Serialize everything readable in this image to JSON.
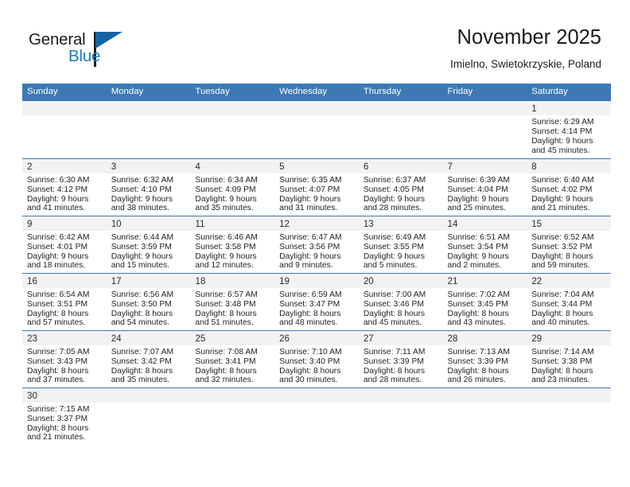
{
  "brand": {
    "name_top": "General",
    "name_bottom": "Blue",
    "accent_color": "#1a7cc4",
    "flag_color": "#1464a5"
  },
  "header": {
    "month_title": "November 2025",
    "location": "Imielno, Swietokrzyskie, Poland"
  },
  "calendar": {
    "header_color": "#3c79b4",
    "daynum_band_color": "#f2f2f2",
    "weekday_headers": [
      "Sunday",
      "Monday",
      "Tuesday",
      "Wednesday",
      "Thursday",
      "Friday",
      "Saturday"
    ],
    "weeks": [
      [
        {
          "blank": true
        },
        {
          "blank": true
        },
        {
          "blank": true
        },
        {
          "blank": true
        },
        {
          "blank": true
        },
        {
          "blank": true
        },
        {
          "day": "1",
          "sunrise": "Sunrise: 6:29 AM",
          "sunset": "Sunset: 4:14 PM",
          "daylight_1": "Daylight: 9 hours",
          "daylight_2": "and 45 minutes."
        }
      ],
      [
        {
          "day": "2",
          "sunrise": "Sunrise: 6:30 AM",
          "sunset": "Sunset: 4:12 PM",
          "daylight_1": "Daylight: 9 hours",
          "daylight_2": "and 41 minutes."
        },
        {
          "day": "3",
          "sunrise": "Sunrise: 6:32 AM",
          "sunset": "Sunset: 4:10 PM",
          "daylight_1": "Daylight: 9 hours",
          "daylight_2": "and 38 minutes."
        },
        {
          "day": "4",
          "sunrise": "Sunrise: 6:34 AM",
          "sunset": "Sunset: 4:09 PM",
          "daylight_1": "Daylight: 9 hours",
          "daylight_2": "and 35 minutes."
        },
        {
          "day": "5",
          "sunrise": "Sunrise: 6:35 AM",
          "sunset": "Sunset: 4:07 PM",
          "daylight_1": "Daylight: 9 hours",
          "daylight_2": "and 31 minutes."
        },
        {
          "day": "6",
          "sunrise": "Sunrise: 6:37 AM",
          "sunset": "Sunset: 4:05 PM",
          "daylight_1": "Daylight: 9 hours",
          "daylight_2": "and 28 minutes."
        },
        {
          "day": "7",
          "sunrise": "Sunrise: 6:39 AM",
          "sunset": "Sunset: 4:04 PM",
          "daylight_1": "Daylight: 9 hours",
          "daylight_2": "and 25 minutes."
        },
        {
          "day": "8",
          "sunrise": "Sunrise: 6:40 AM",
          "sunset": "Sunset: 4:02 PM",
          "daylight_1": "Daylight: 9 hours",
          "daylight_2": "and 21 minutes."
        }
      ],
      [
        {
          "day": "9",
          "sunrise": "Sunrise: 6:42 AM",
          "sunset": "Sunset: 4:01 PM",
          "daylight_1": "Daylight: 9 hours",
          "daylight_2": "and 18 minutes."
        },
        {
          "day": "10",
          "sunrise": "Sunrise: 6:44 AM",
          "sunset": "Sunset: 3:59 PM",
          "daylight_1": "Daylight: 9 hours",
          "daylight_2": "and 15 minutes."
        },
        {
          "day": "11",
          "sunrise": "Sunrise: 6:46 AM",
          "sunset": "Sunset: 3:58 PM",
          "daylight_1": "Daylight: 9 hours",
          "daylight_2": "and 12 minutes."
        },
        {
          "day": "12",
          "sunrise": "Sunrise: 6:47 AM",
          "sunset": "Sunset: 3:56 PM",
          "daylight_1": "Daylight: 9 hours",
          "daylight_2": "and 9 minutes."
        },
        {
          "day": "13",
          "sunrise": "Sunrise: 6:49 AM",
          "sunset": "Sunset: 3:55 PM",
          "daylight_1": "Daylight: 9 hours",
          "daylight_2": "and 5 minutes."
        },
        {
          "day": "14",
          "sunrise": "Sunrise: 6:51 AM",
          "sunset": "Sunset: 3:54 PM",
          "daylight_1": "Daylight: 9 hours",
          "daylight_2": "and 2 minutes."
        },
        {
          "day": "15",
          "sunrise": "Sunrise: 6:52 AM",
          "sunset": "Sunset: 3:52 PM",
          "daylight_1": "Daylight: 8 hours",
          "daylight_2": "and 59 minutes."
        }
      ],
      [
        {
          "day": "16",
          "sunrise": "Sunrise: 6:54 AM",
          "sunset": "Sunset: 3:51 PM",
          "daylight_1": "Daylight: 8 hours",
          "daylight_2": "and 57 minutes."
        },
        {
          "day": "17",
          "sunrise": "Sunrise: 6:56 AM",
          "sunset": "Sunset: 3:50 PM",
          "daylight_1": "Daylight: 8 hours",
          "daylight_2": "and 54 minutes."
        },
        {
          "day": "18",
          "sunrise": "Sunrise: 6:57 AM",
          "sunset": "Sunset: 3:48 PM",
          "daylight_1": "Daylight: 8 hours",
          "daylight_2": "and 51 minutes."
        },
        {
          "day": "19",
          "sunrise": "Sunrise: 6:59 AM",
          "sunset": "Sunset: 3:47 PM",
          "daylight_1": "Daylight: 8 hours",
          "daylight_2": "and 48 minutes."
        },
        {
          "day": "20",
          "sunrise": "Sunrise: 7:00 AM",
          "sunset": "Sunset: 3:46 PM",
          "daylight_1": "Daylight: 8 hours",
          "daylight_2": "and 45 minutes."
        },
        {
          "day": "21",
          "sunrise": "Sunrise: 7:02 AM",
          "sunset": "Sunset: 3:45 PM",
          "daylight_1": "Daylight: 8 hours",
          "daylight_2": "and 43 minutes."
        },
        {
          "day": "22",
          "sunrise": "Sunrise: 7:04 AM",
          "sunset": "Sunset: 3:44 PM",
          "daylight_1": "Daylight: 8 hours",
          "daylight_2": "and 40 minutes."
        }
      ],
      [
        {
          "day": "23",
          "sunrise": "Sunrise: 7:05 AM",
          "sunset": "Sunset: 3:43 PM",
          "daylight_1": "Daylight: 8 hours",
          "daylight_2": "and 37 minutes."
        },
        {
          "day": "24",
          "sunrise": "Sunrise: 7:07 AM",
          "sunset": "Sunset: 3:42 PM",
          "daylight_1": "Daylight: 8 hours",
          "daylight_2": "and 35 minutes."
        },
        {
          "day": "25",
          "sunrise": "Sunrise: 7:08 AM",
          "sunset": "Sunset: 3:41 PM",
          "daylight_1": "Daylight: 8 hours",
          "daylight_2": "and 32 minutes."
        },
        {
          "day": "26",
          "sunrise": "Sunrise: 7:10 AM",
          "sunset": "Sunset: 3:40 PM",
          "daylight_1": "Daylight: 8 hours",
          "daylight_2": "and 30 minutes."
        },
        {
          "day": "27",
          "sunrise": "Sunrise: 7:11 AM",
          "sunset": "Sunset: 3:39 PM",
          "daylight_1": "Daylight: 8 hours",
          "daylight_2": "and 28 minutes."
        },
        {
          "day": "28",
          "sunrise": "Sunrise: 7:13 AM",
          "sunset": "Sunset: 3:39 PM",
          "daylight_1": "Daylight: 8 hours",
          "daylight_2": "and 26 minutes."
        },
        {
          "day": "29",
          "sunrise": "Sunrise: 7:14 AM",
          "sunset": "Sunset: 3:38 PM",
          "daylight_1": "Daylight: 8 hours",
          "daylight_2": "and 23 minutes."
        }
      ],
      [
        {
          "day": "30",
          "sunrise": "Sunrise: 7:15 AM",
          "sunset": "Sunset: 3:37 PM",
          "daylight_1": "Daylight: 8 hours",
          "daylight_2": "and 21 minutes."
        },
        {
          "blank": true
        },
        {
          "blank": true
        },
        {
          "blank": true
        },
        {
          "blank": true
        },
        {
          "blank": true
        },
        {
          "blank": true
        }
      ]
    ]
  }
}
